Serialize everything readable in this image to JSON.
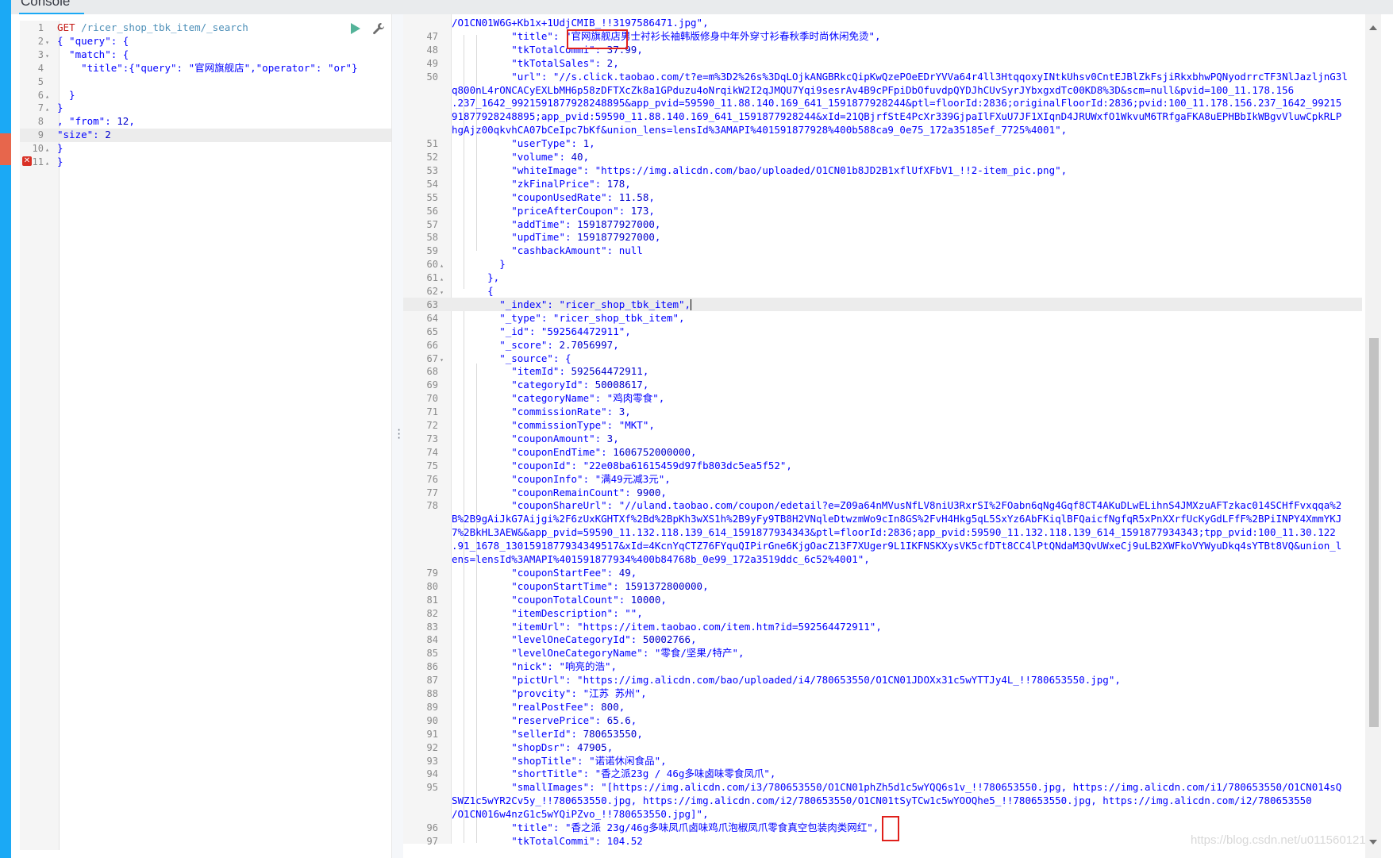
{
  "app": {
    "tab_title": "Console"
  },
  "request": {
    "lines": [
      {
        "n": "1",
        "fold": "",
        "segs": [
          {
            "t": "GET ",
            "c": "mth"
          },
          {
            "t": "/ricer_shop_tbk_item/_search",
            "c": "url"
          }
        ]
      },
      {
        "n": "2",
        "fold": "▾",
        "segs": [
          {
            "t": "{ \"query\": {",
            "c": "txt"
          }
        ]
      },
      {
        "n": "3",
        "fold": "▾",
        "segs": [
          {
            "t": "  \"match\": {",
            "c": "txt"
          }
        ]
      },
      {
        "n": "4",
        "fold": "",
        "segs": [
          {
            "t": "    \"title\":{\"query\": \"官网旗舰店\",\"operator\": \"or\"}",
            "c": "txt"
          }
        ]
      },
      {
        "n": "5",
        "fold": "",
        "segs": []
      },
      {
        "n": "6",
        "fold": "▴",
        "segs": [
          {
            "t": "  }",
            "c": "txt"
          }
        ]
      },
      {
        "n": "7",
        "fold": "▴",
        "segs": [
          {
            "t": "}",
            "c": "txt"
          }
        ]
      },
      {
        "n": "8",
        "fold": "",
        "segs": [
          {
            "t": ", \"from\": ",
            "c": "txt"
          },
          {
            "t": "12",
            "c": "num"
          },
          {
            "t": ",",
            "c": "txt"
          }
        ]
      },
      {
        "n": "9",
        "fold": "",
        "segs": [
          {
            "t": "\"size\": ",
            "c": "txt"
          },
          {
            "t": "2",
            "c": "num"
          }
        ]
      },
      {
        "n": "10",
        "fold": "▴",
        "segs": [
          {
            "t": "}",
            "c": "txt"
          }
        ]
      },
      {
        "n": "11",
        "fold": "▴",
        "segs": [
          {
            "t": "}",
            "c": "txt"
          }
        ]
      }
    ]
  },
  "response": {
    "lines": [
      {
        "n": "",
        "fold": "",
        "segs": [
          {
            "t": "/O1CN01W6G+Kb1x+1UdjCMIB_!!3197586471.jpg\",",
            "c": "txt"
          }
        ]
      },
      {
        "n": "47",
        "fold": "",
        "segs": [
          {
            "t": "          \"title\": \"官网旗舰店男士衬衫长袖韩版修身中年外穿寸衫春秋季时尚休闲免烫\",",
            "c": "txt"
          }
        ]
      },
      {
        "n": "48",
        "fold": "",
        "segs": [
          {
            "t": "          \"tkTotalCommi\": ",
            "c": "txt"
          },
          {
            "t": "37.99",
            "c": "num"
          },
          {
            "t": ",",
            "c": "txt"
          }
        ]
      },
      {
        "n": "49",
        "fold": "",
        "segs": [
          {
            "t": "          \"tkTotalSales\": ",
            "c": "txt"
          },
          {
            "t": "2",
            "c": "num"
          },
          {
            "t": ",",
            "c": "txt"
          }
        ]
      },
      {
        "n": "50",
        "fold": "",
        "segs": [
          {
            "t": "          \"url\": \"//s.click.taobao.com/t?e=m%3D2%26s%3DqLOjkANGBRkcQipKwQzePOeEDrYVVa64r4ll3HtqqoxyINtkUhsv0CntEJBlZkFsjiRkxbhwPQNyodrrcTF3NlJazljnG3l",
            "c": "txt"
          }
        ]
      },
      {
        "n": "",
        "fold": "",
        "segs": [
          {
            "t": "q800nL4rONCACyEXLbMH6p58zDFTXcZk8a1GPduzu4oNrqikW2I2qJMQU7Yqi9sesrAv4B9cPFpiDbOfuvdpQYDJhCUvSyrJYbxgxdTc00KD8%3D&scm=null&pvid=100_11.178.156",
            "c": "txt"
          }
        ]
      },
      {
        "n": "",
        "fold": "",
        "segs": [
          {
            "t": ".237_1642_9921591877928248895&app_pvid=59590_11.88.140.169_641_1591877928244&ptl=floorId:2836;originalFloorId:2836;pvid:100_11.178.156.237_1642_99215",
            "c": "txt"
          }
        ]
      },
      {
        "n": "",
        "fold": "",
        "segs": [
          {
            "t": "91877928248895;app_pvid:59590_11.88.140.169_641_1591877928244&xId=21QBjrfStE4PcXr339GjpaIlFXuU7JF1XIqnD4JRUWxfO1WkvuM6TRfgaFKA8uEPHBbIkWBgvVluwCpkRLP",
            "c": "txt"
          }
        ]
      },
      {
        "n": "",
        "fold": "",
        "segs": [
          {
            "t": "hgAjz00qkvhCA07bCeIpc7bKf&union_lens=lensId%3AMAPI%401591877928%400b588ca9_0e75_172a35185ef_7725%4001\",",
            "c": "txt"
          }
        ]
      },
      {
        "n": "51",
        "fold": "",
        "segs": [
          {
            "t": "          \"userType\": ",
            "c": "txt"
          },
          {
            "t": "1",
            "c": "num"
          },
          {
            "t": ",",
            "c": "txt"
          }
        ]
      },
      {
        "n": "52",
        "fold": "",
        "segs": [
          {
            "t": "          \"volume\": ",
            "c": "txt"
          },
          {
            "t": "40",
            "c": "num"
          },
          {
            "t": ",",
            "c": "txt"
          }
        ]
      },
      {
        "n": "53",
        "fold": "",
        "segs": [
          {
            "t": "          \"whiteImage\": \"https://img.alicdn.com/bao/uploaded/O1CN01b8JD2B1xflUfXFbV1_!!2-item_pic.png\",",
            "c": "txt"
          }
        ]
      },
      {
        "n": "54",
        "fold": "",
        "segs": [
          {
            "t": "          \"zkFinalPrice\": ",
            "c": "txt"
          },
          {
            "t": "178",
            "c": "num"
          },
          {
            "t": ",",
            "c": "txt"
          }
        ]
      },
      {
        "n": "55",
        "fold": "",
        "segs": [
          {
            "t": "          \"couponUsedRate\": ",
            "c": "txt"
          },
          {
            "t": "11.58",
            "c": "num"
          },
          {
            "t": ",",
            "c": "txt"
          }
        ]
      },
      {
        "n": "56",
        "fold": "",
        "segs": [
          {
            "t": "          \"priceAfterCoupon\": ",
            "c": "txt"
          },
          {
            "t": "173",
            "c": "num"
          },
          {
            "t": ",",
            "c": "txt"
          }
        ]
      },
      {
        "n": "57",
        "fold": "",
        "segs": [
          {
            "t": "          \"addTime\": ",
            "c": "txt"
          },
          {
            "t": "1591877927000",
            "c": "num"
          },
          {
            "t": ",",
            "c": "txt"
          }
        ]
      },
      {
        "n": "58",
        "fold": "",
        "segs": [
          {
            "t": "          \"updTime\": ",
            "c": "txt"
          },
          {
            "t": "1591877927000",
            "c": "num"
          },
          {
            "t": ",",
            "c": "txt"
          }
        ]
      },
      {
        "n": "59",
        "fold": "",
        "segs": [
          {
            "t": "          \"cashbackAmount\": null",
            "c": "txt"
          }
        ]
      },
      {
        "n": "60",
        "fold": "▴",
        "segs": [
          {
            "t": "        }",
            "c": "txt"
          }
        ]
      },
      {
        "n": "61",
        "fold": "▴",
        "segs": [
          {
            "t": "      },",
            "c": "txt"
          }
        ]
      },
      {
        "n": "62",
        "fold": "▾",
        "segs": [
          {
            "t": "      {",
            "c": "txt"
          }
        ]
      },
      {
        "n": "63",
        "fold": "",
        "segs": [
          {
            "t": "        \"_index\": \"ricer_shop_tbk_item\",",
            "c": "txt"
          },
          {
            "t": "",
            "c": "cursor"
          }
        ]
      },
      {
        "n": "64",
        "fold": "",
        "segs": [
          {
            "t": "        \"_type\": \"ricer_shop_tbk_item\",",
            "c": "txt"
          }
        ]
      },
      {
        "n": "65",
        "fold": "",
        "segs": [
          {
            "t": "        \"_id\": \"592564472911\",",
            "c": "txt"
          }
        ]
      },
      {
        "n": "66",
        "fold": "",
        "segs": [
          {
            "t": "        \"_score\": ",
            "c": "txt"
          },
          {
            "t": "2.7056997",
            "c": "num"
          },
          {
            "t": ",",
            "c": "txt"
          }
        ]
      },
      {
        "n": "67",
        "fold": "▾",
        "segs": [
          {
            "t": "        \"_source\": {",
            "c": "txt"
          }
        ]
      },
      {
        "n": "68",
        "fold": "",
        "segs": [
          {
            "t": "          \"itemId\": ",
            "c": "txt"
          },
          {
            "t": "592564472911",
            "c": "num"
          },
          {
            "t": ",",
            "c": "txt"
          }
        ]
      },
      {
        "n": "69",
        "fold": "",
        "segs": [
          {
            "t": "          \"categoryId\": ",
            "c": "txt"
          },
          {
            "t": "50008617",
            "c": "num"
          },
          {
            "t": ",",
            "c": "txt"
          }
        ]
      },
      {
        "n": "70",
        "fold": "",
        "segs": [
          {
            "t": "          \"categoryName\": \"鸡肉零食\",",
            "c": "txt"
          }
        ]
      },
      {
        "n": "71",
        "fold": "",
        "segs": [
          {
            "t": "          \"commissionRate\": ",
            "c": "txt"
          },
          {
            "t": "3",
            "c": "num"
          },
          {
            "t": ",",
            "c": "txt"
          }
        ]
      },
      {
        "n": "72",
        "fold": "",
        "segs": [
          {
            "t": "          \"commissionType\": \"MKT\",",
            "c": "txt"
          }
        ]
      },
      {
        "n": "73",
        "fold": "",
        "segs": [
          {
            "t": "          \"couponAmount\": ",
            "c": "txt"
          },
          {
            "t": "3",
            "c": "num"
          },
          {
            "t": ",",
            "c": "txt"
          }
        ]
      },
      {
        "n": "74",
        "fold": "",
        "segs": [
          {
            "t": "          \"couponEndTime\": ",
            "c": "txt"
          },
          {
            "t": "1606752000000",
            "c": "num"
          },
          {
            "t": ",",
            "c": "txt"
          }
        ]
      },
      {
        "n": "75",
        "fold": "",
        "segs": [
          {
            "t": "          \"couponId\": \"22e08ba61615459d97fb803dc5ea5f52\",",
            "c": "txt"
          }
        ]
      },
      {
        "n": "76",
        "fold": "",
        "segs": [
          {
            "t": "          \"couponInfo\": \"满49元减3元\",",
            "c": "txt"
          }
        ]
      },
      {
        "n": "77",
        "fold": "",
        "segs": [
          {
            "t": "          \"couponRemainCount\": ",
            "c": "txt"
          },
          {
            "t": "9900",
            "c": "num"
          },
          {
            "t": ",",
            "c": "txt"
          }
        ]
      },
      {
        "n": "78",
        "fold": "",
        "segs": [
          {
            "t": "          \"couponShareUrl\": \"//uland.taobao.com/coupon/edetail?e=Z09a64nMVusNfLV8niU3RxrSI%2FOabn6qNg4Gqf8CT4AKuDLwELihnS4JMXzuAFTzkac014SCHfFvxqqa%2",
            "c": "txt"
          }
        ]
      },
      {
        "n": "",
        "fold": "",
        "segs": [
          {
            "t": "B%2B9gAiJkG7Aijgi%2F6zUxKGHTXf%2Bd%2BpKh3wXS1h%2B9yFy9TB8H2VNqleDtwzmWo9cIn8GS%2FvH4Hkg5qL5SxYz6AbFKiqlBFQaicfNgfqR5xPnXXrfUcKyGdLFfF%2BPiINPY4XmmYKJ",
            "c": "txt"
          }
        ]
      },
      {
        "n": "",
        "fold": "",
        "segs": [
          {
            "t": "7%2BkHL3AEW&&app_pvid=59590_11.132.118.139_614_1591877934343&ptl=floorId:2836;app_pvid:59590_11.132.118.139_614_1591877934343;tpp_pvid:100_11.30.122",
            "c": "txt"
          }
        ]
      },
      {
        "n": "",
        "fold": "",
        "segs": [
          {
            "t": ".91_1678_1301591877934349517&xId=4KcnYqCTZ76FYquQIPirGne6KjgOacZ13F7XUger9L1IKFNSKXysVK5cfDTt8CC4lPtQNdaM3QvUWxeCj9uLB2XWFkoVYWyuDkq4sYTBt8VQ&union_l",
            "c": "txt"
          }
        ]
      },
      {
        "n": "",
        "fold": "",
        "segs": [
          {
            "t": "ens=lensId%3AMAPI%401591877934%400b84768b_0e99_172a3519ddc_6c52%4001\",",
            "c": "txt"
          }
        ]
      },
      {
        "n": "79",
        "fold": "",
        "segs": [
          {
            "t": "          \"couponStartFee\": ",
            "c": "txt"
          },
          {
            "t": "49",
            "c": "num"
          },
          {
            "t": ",",
            "c": "txt"
          }
        ]
      },
      {
        "n": "80",
        "fold": "",
        "segs": [
          {
            "t": "          \"couponStartTime\": ",
            "c": "txt"
          },
          {
            "t": "1591372800000",
            "c": "num"
          },
          {
            "t": ",",
            "c": "txt"
          }
        ]
      },
      {
        "n": "81",
        "fold": "",
        "segs": [
          {
            "t": "          \"couponTotalCount\": ",
            "c": "txt"
          },
          {
            "t": "10000",
            "c": "num"
          },
          {
            "t": ",",
            "c": "txt"
          }
        ]
      },
      {
        "n": "82",
        "fold": "",
        "segs": [
          {
            "t": "          \"itemDescription\": \"\",",
            "c": "txt"
          }
        ]
      },
      {
        "n": "83",
        "fold": "",
        "segs": [
          {
            "t": "          \"itemUrl\": \"https://item.taobao.com/item.htm?id=592564472911\",",
            "c": "txt"
          }
        ]
      },
      {
        "n": "84",
        "fold": "",
        "segs": [
          {
            "t": "          \"levelOneCategoryId\": ",
            "c": "txt"
          },
          {
            "t": "50002766",
            "c": "num"
          },
          {
            "t": ",",
            "c": "txt"
          }
        ]
      },
      {
        "n": "85",
        "fold": "",
        "segs": [
          {
            "t": "          \"levelOneCategoryName\": \"零食/坚果/特产\",",
            "c": "txt"
          }
        ]
      },
      {
        "n": "86",
        "fold": "",
        "segs": [
          {
            "t": "          \"nick\": \"响亮的浩\",",
            "c": "txt"
          }
        ]
      },
      {
        "n": "87",
        "fold": "",
        "segs": [
          {
            "t": "          \"pictUrl\": \"https://img.alicdn.com/bao/uploaded/i4/780653550/O1CN01JDOXx31c5wYTTJy4L_!!780653550.jpg\",",
            "c": "txt"
          }
        ]
      },
      {
        "n": "88",
        "fold": "",
        "segs": [
          {
            "t": "          \"provcity\": \"江苏 苏州\",",
            "c": "txt"
          }
        ]
      },
      {
        "n": "89",
        "fold": "",
        "segs": [
          {
            "t": "          \"realPostFee\": ",
            "c": "txt"
          },
          {
            "t": "800",
            "c": "num"
          },
          {
            "t": ",",
            "c": "txt"
          }
        ]
      },
      {
        "n": "90",
        "fold": "",
        "segs": [
          {
            "t": "          \"reservePrice\": ",
            "c": "txt"
          },
          {
            "t": "65.6",
            "c": "num"
          },
          {
            "t": ",",
            "c": "txt"
          }
        ]
      },
      {
        "n": "91",
        "fold": "",
        "segs": [
          {
            "t": "          \"sellerId\": ",
            "c": "txt"
          },
          {
            "t": "780653550",
            "c": "num"
          },
          {
            "t": ",",
            "c": "txt"
          }
        ]
      },
      {
        "n": "92",
        "fold": "",
        "segs": [
          {
            "t": "          \"shopDsr\": ",
            "c": "txt"
          },
          {
            "t": "47905",
            "c": "num"
          },
          {
            "t": ",",
            "c": "txt"
          }
        ]
      },
      {
        "n": "93",
        "fold": "",
        "segs": [
          {
            "t": "          \"shopTitle\": \"诺诺休闲食品\",",
            "c": "txt"
          }
        ]
      },
      {
        "n": "94",
        "fold": "",
        "segs": [
          {
            "t": "          \"shortTitle\": \"香之派23g / 46g多味卤味零食凤爪\",",
            "c": "txt"
          }
        ]
      },
      {
        "n": "95",
        "fold": "",
        "segs": [
          {
            "t": "          \"smallImages\": \"[https://img.alicdn.com/i3/780653550/O1CN01phZh5d1c5wYQQ6s1v_!!780653550.jpg, https://img.alicdn.com/i1/780653550/O1CN014sQ",
            "c": "txt"
          }
        ]
      },
      {
        "n": "",
        "fold": "",
        "segs": [
          {
            "t": "SWZ1c5wYR2Cv5y_!!780653550.jpg, https://img.alicdn.com/i2/780653550/O1CN01tSyTCw1c5wYOOQhe5_!!780653550.jpg, https://img.alicdn.com/i2/780653550",
            "c": "txt"
          }
        ]
      },
      {
        "n": "",
        "fold": "",
        "segs": [
          {
            "t": "/O1CN016w4nzG1c5wYQiPZvo_!!780653550.jpg]\",",
            "c": "txt"
          }
        ]
      },
      {
        "n": "96",
        "fold": "",
        "segs": [
          {
            "t": "          \"title\": \"香之派 23g/46g多味凤爪卤味鸡爪泡椒凤爪零食真空包装肉类网红\",",
            "c": "txt"
          }
        ]
      },
      {
        "n": "97",
        "fold": "",
        "segs": [
          {
            "t": "          \"tkTotalCommi\": 104.52",
            "c": "txt"
          }
        ]
      }
    ]
  },
  "watermark": "https://blog.csdn.net/u011560121"
}
